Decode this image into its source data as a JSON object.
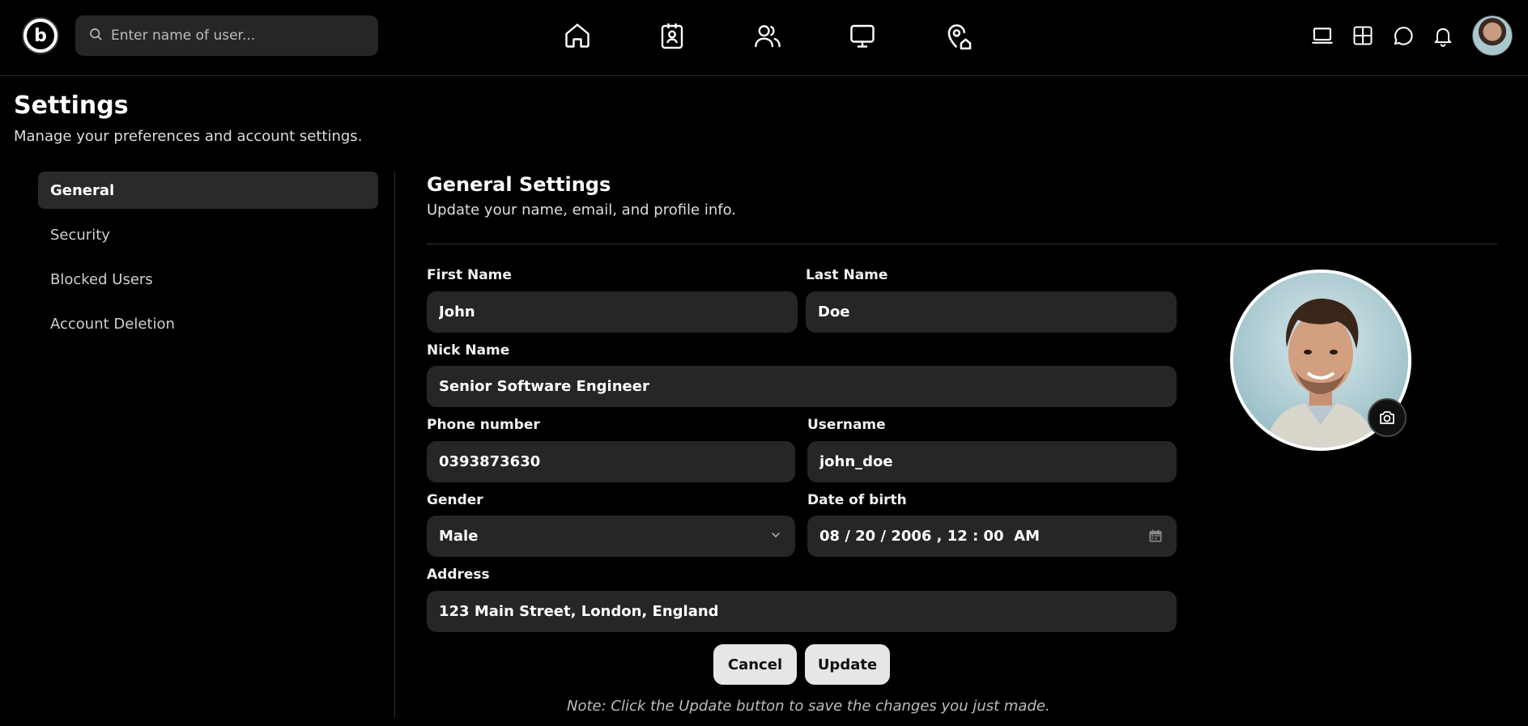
{
  "topbar": {
    "logo_letter": "b",
    "search_placeholder": "Enter name of user..."
  },
  "page": {
    "title": "Settings",
    "subtitle": "Manage your preferences and account settings."
  },
  "sidebar": {
    "items": [
      {
        "label": "General",
        "active": true
      },
      {
        "label": "Security",
        "active": false
      },
      {
        "label": "Blocked Users",
        "active": false
      },
      {
        "label": "Account Deletion",
        "active": false
      }
    ]
  },
  "section": {
    "title": "General Settings",
    "subtitle": "Update your name, email, and profile info."
  },
  "form": {
    "first_name": {
      "label": "First Name",
      "value": "John"
    },
    "last_name": {
      "label": "Last Name",
      "value": "Doe"
    },
    "nick_name": {
      "label": "Nick Name",
      "value": "Senior Software Engineer"
    },
    "phone": {
      "label": "Phone number",
      "value": "0393873630"
    },
    "username": {
      "label": "Username",
      "value": "john_doe"
    },
    "gender": {
      "label": "Gender",
      "value": "Male"
    },
    "dob": {
      "label": "Date of birth",
      "value": "08 / 20 / 2006 , 12 : 00  AM"
    },
    "address": {
      "label": "Address",
      "value": "123 Main Street, London, England"
    }
  },
  "actions": {
    "cancel_label": "Cancel",
    "update_label": "Update",
    "note": "Note: Click the Update button to save the changes you just made."
  },
  "icons": {
    "nav": [
      "home-icon",
      "contact-badge-icon",
      "users-icon",
      "monitor-icon",
      "location-home-icon"
    ],
    "right": [
      "laptop-icon",
      "grid-icon",
      "chat-icon",
      "bell-icon"
    ]
  },
  "colors": {
    "background": "#000000",
    "field_bg": "#262626",
    "button_bg": "#e6e6e6"
  }
}
